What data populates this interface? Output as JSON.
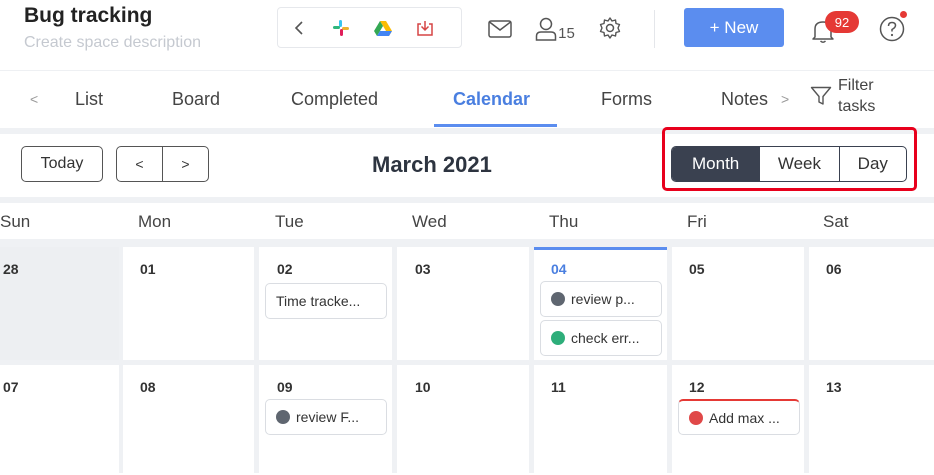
{
  "header": {
    "title": "Bug tracking",
    "subtitle": "Create space description",
    "members_count": "15",
    "new_label": "+ New",
    "notifications": "92"
  },
  "tabs": [
    {
      "label": "List"
    },
    {
      "label": "Board"
    },
    {
      "label": "Completed"
    },
    {
      "label": "Calendar"
    },
    {
      "label": "Forms"
    },
    {
      "label": "Notes"
    }
  ],
  "filter": {
    "line1": "Filter",
    "line2": "tasks"
  },
  "toolbar": {
    "today": "Today",
    "prev": "<",
    "next": ">",
    "month_title": "March 2021",
    "views": [
      "Month",
      "Week",
      "Day"
    ],
    "active_view": "Month"
  },
  "weekdays": [
    "Sun",
    "Mon",
    "Tue",
    "Wed",
    "Thu",
    "Fri",
    "Sat"
  ],
  "weeks": [
    {
      "days": [
        "28",
        "01",
        "02",
        "03",
        "04",
        "05",
        "06"
      ]
    },
    {
      "days": [
        "07",
        "08",
        "09",
        "10",
        "11",
        "12",
        "13"
      ]
    }
  ],
  "tasks": {
    "d02": "Time tracke...",
    "d04a": "review p...",
    "d04b": "check err...",
    "d09": "review F...",
    "d12": "Add max ..."
  },
  "colors": {
    "accent": "#5b8def",
    "highlight_box": "#e8001c",
    "badge": "#e53935",
    "active_view_bg": "#3a4150"
  }
}
